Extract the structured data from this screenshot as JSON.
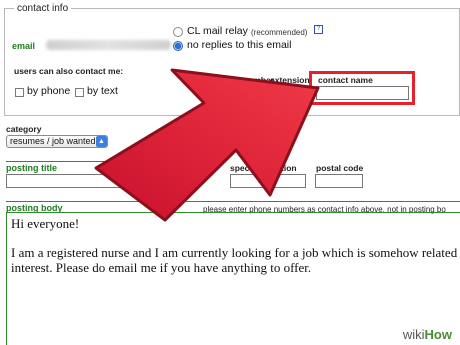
{
  "contact": {
    "legend": "contact info",
    "email_label": "email",
    "relay_option": "CL mail relay",
    "relay_note": "(recommended)",
    "help_icon": "?",
    "no_replies_option": "no replies to this email",
    "also_contact": "users can also contact me:",
    "by_phone": "by phone",
    "by_text": "by text",
    "phone_number": "phone number",
    "extension": "extension",
    "contact_name": "contact name"
  },
  "category": {
    "label": "category",
    "selected": "resumes / job wanted"
  },
  "posting": {
    "title_label": "posting title",
    "location_label": "specific location",
    "postal_label": "postal code",
    "body_label": "posting body",
    "body_hint": "please enter phone numbers as contact info above, not in posting bo",
    "body_line1": "Hi everyone!",
    "body_line2": "I am a registered nurse and I am currently looking for a job which is somehow related to my field",
    "body_line3": "interest. Please do email me if you have anything to offer."
  },
  "watermark": {
    "wiki": "wiki",
    "how": "How"
  },
  "colors": {
    "arrow": "#e0263a",
    "highlight": "#e8202a",
    "label_green": "#1e7d1e"
  }
}
